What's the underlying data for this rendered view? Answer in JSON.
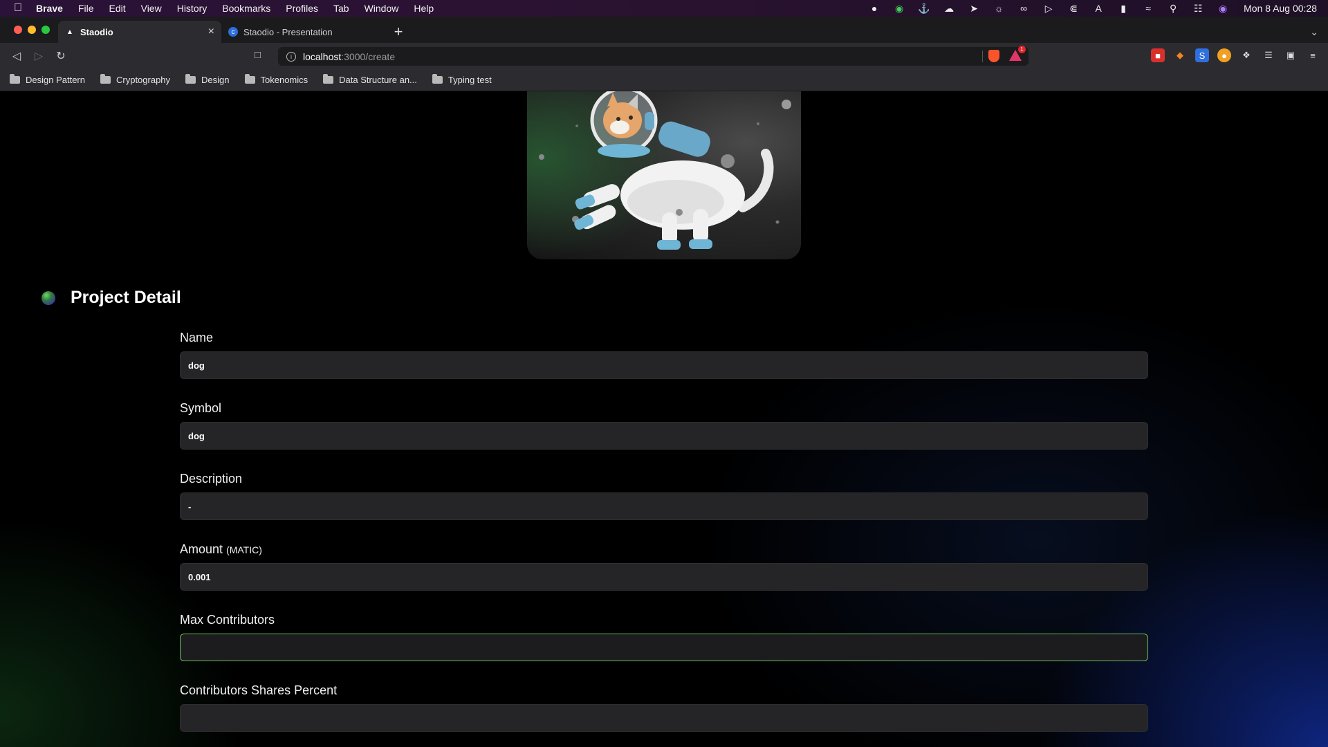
{
  "menubar": {
    "app": "Brave",
    "items": [
      "File",
      "Edit",
      "View",
      "History",
      "Bookmarks",
      "Profiles",
      "Tab",
      "Window",
      "Help"
    ],
    "clock": "Mon 8 Aug  00:28"
  },
  "tabs": [
    {
      "title": "Staodio",
      "active": true
    },
    {
      "title": "Staodio - Presentation",
      "active": false
    }
  ],
  "address": {
    "host": "localhost",
    "path": ":3000/create",
    "rewards_badge": "1"
  },
  "bookmarks": [
    "Design Pattern",
    "Cryptography",
    "Design",
    "Tokenomics",
    "Data Structure an...",
    "Typing test"
  ],
  "form": {
    "title": "Project Detail",
    "fields": [
      {
        "label": "Name",
        "value": "dog",
        "unit": ""
      },
      {
        "label": "Symbol",
        "value": "dog",
        "unit": ""
      },
      {
        "label": "Description",
        "value": "-",
        "unit": ""
      },
      {
        "label": "Amount",
        "value": "0.001",
        "unit": "(MATIC)"
      },
      {
        "label": "Max Contributors",
        "value": "",
        "unit": ""
      },
      {
        "label": "Contributors Shares Percent",
        "value": "",
        "unit": ""
      }
    ]
  },
  "colors": {
    "focus_border": "#6abf5a",
    "input_bg": "#252527",
    "accent_blue": "#1432aa"
  }
}
